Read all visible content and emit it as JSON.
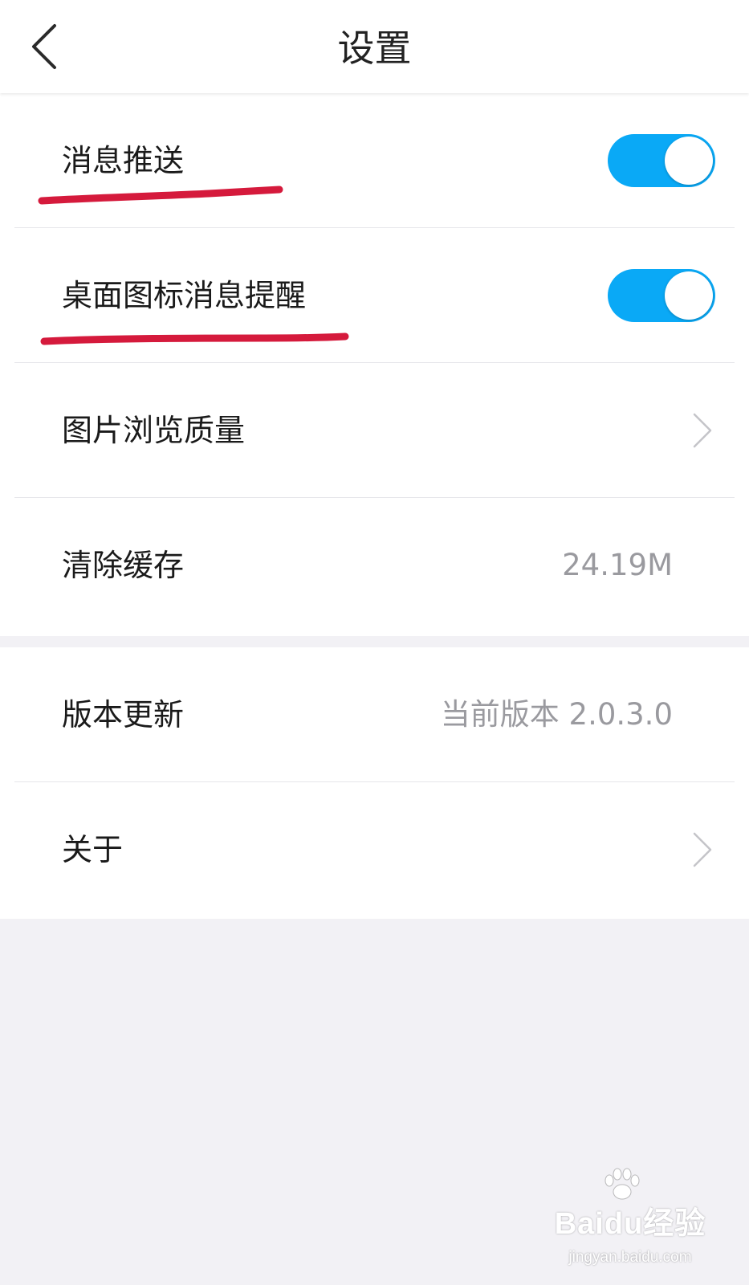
{
  "nav": {
    "title": "设置",
    "back_icon": "chevron-left-icon"
  },
  "settings": {
    "push_notifications": {
      "label": "消息推送",
      "enabled": true
    },
    "desktop_icon_badge": {
      "label": "桌面图标消息提醒",
      "enabled": true
    },
    "image_quality": {
      "label": "图片浏览质量",
      "icon": "chevron-right-icon"
    },
    "clear_cache": {
      "label": "清除缓存",
      "value": "24.19M"
    }
  },
  "info": {
    "version_update": {
      "label": "版本更新",
      "value": "当前版本 2.0.3.0"
    },
    "about": {
      "label": "关于",
      "icon": "chevron-right-icon"
    }
  },
  "watermark": {
    "logo": "Baidu经验",
    "url": "jingyan.baidu.com"
  },
  "colors": {
    "toggle_on": "#0aa9f6",
    "annotation_underline": "#d51a3c",
    "page_background": "#f2f1f5",
    "secondary_text": "#9a9a9f"
  }
}
